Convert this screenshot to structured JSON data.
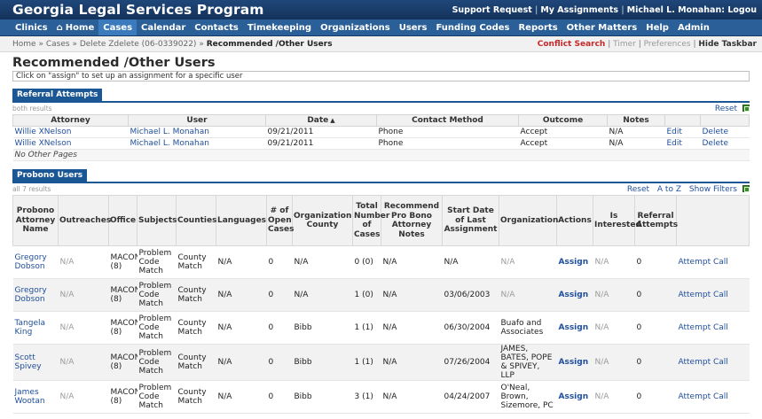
{
  "app": {
    "title": "Georgia Legal Services Program",
    "top_links": [
      "Support Request",
      "My Assignments",
      "Michael L. Monahan: Logou"
    ]
  },
  "nav": [
    {
      "label": "Clinics",
      "active": false,
      "icon": ""
    },
    {
      "label": "Home",
      "active": false,
      "icon": "home-icon"
    },
    {
      "label": "Cases",
      "active": true,
      "icon": ""
    },
    {
      "label": "Calendar",
      "active": false,
      "icon": ""
    },
    {
      "label": "Contacts",
      "active": false,
      "icon": ""
    },
    {
      "label": "Timekeeping",
      "active": false,
      "icon": ""
    },
    {
      "label": "Organizations",
      "active": false,
      "icon": ""
    },
    {
      "label": "Users",
      "active": false,
      "icon": ""
    },
    {
      "label": "Funding Codes",
      "active": false,
      "icon": ""
    },
    {
      "label": "Reports",
      "active": false,
      "icon": ""
    },
    {
      "label": "Other Matters",
      "active": false,
      "icon": ""
    },
    {
      "label": "Help",
      "active": false,
      "icon": ""
    },
    {
      "label": "Admin",
      "active": false,
      "icon": ""
    }
  ],
  "breadcrumb": {
    "items": [
      "Home",
      "Cases",
      "Delete Zdelete (06-0339022)"
    ],
    "separator": "»",
    "current": "Recommended /Other Users"
  },
  "tools": {
    "conflict_search": "Conflict Search",
    "timer": "Timer",
    "preferences": "Preferences",
    "hide_taskbar": "Hide Taskbar"
  },
  "page": {
    "title": "Recommended /Other Users",
    "instruction": "Click on \"assign\" to set up an assignment for a specific user"
  },
  "referral": {
    "tab_label": "Referral Attempts",
    "count_text": "both results",
    "reset_label": "Reset",
    "columns": [
      "Attorney",
      "User",
      "Date",
      "Contact Method",
      "Outcome",
      "Notes",
      "",
      ""
    ],
    "rows": [
      {
        "attorney": "Willie XNelson",
        "user": "Michael L. Monahan",
        "date": "09/21/2011",
        "method": "Phone",
        "outcome": "Accept",
        "notes": "N/A",
        "edit": "Edit",
        "delete": "Delete"
      },
      {
        "attorney": "Willie XNelson",
        "user": "Michael L. Monahan",
        "date": "09/21/2011",
        "method": "Phone",
        "outcome": "Accept",
        "notes": "N/A",
        "edit": "Edit",
        "delete": "Delete"
      }
    ],
    "footer": "No Other Pages"
  },
  "probono": {
    "tab_label": "Probono Users",
    "count_text": "all 7 results",
    "actions": [
      "Reset",
      "A to Z",
      "Show Filters"
    ],
    "columns": [
      "Probono Attorney Name",
      "Outreaches",
      "Office",
      "Subjects",
      "Counties",
      "Languages",
      "# of Open Cases",
      "Organization County",
      "Total Number of Cases",
      "Recommend Pro Bono Attorney Notes",
      "Start Date of Last Assignment",
      "Organization",
      "Actions",
      "Is Interested",
      "Referral Attempts",
      ""
    ],
    "rows": [
      {
        "name": "Gregory Dobson",
        "outreaches": "N/A",
        "office": "MACON (8)",
        "subjects": "Problem Code Match",
        "counties": "County Match",
        "languages": "N/A",
        "open": "0",
        "org_county": "N/A",
        "total": "0 (0)",
        "notes": "N/A",
        "start": "N/A",
        "organization": "N/A",
        "action": "Assign",
        "interested": "N/A",
        "attempts": "0",
        "attempt_call": "Attempt Call"
      },
      {
        "name": "Gregory Dobson",
        "outreaches": "N/A",
        "office": "MACON (8)",
        "subjects": "Problem Code Match",
        "counties": "County Match",
        "languages": "N/A",
        "open": "0",
        "org_county": "N/A",
        "total": "1 (0)",
        "notes": "N/A",
        "start": "03/06/2003",
        "organization": "N/A",
        "action": "Assign",
        "interested": "N/A",
        "attempts": "0",
        "attempt_call": "Attempt Call"
      },
      {
        "name": "Tangela King",
        "outreaches": "N/A",
        "office": "MACON (8)",
        "subjects": "Problem Code Match",
        "counties": "County Match",
        "languages": "N/A",
        "open": "0",
        "org_county": "Bibb",
        "total": "1 (1)",
        "notes": "N/A",
        "start": "06/30/2004",
        "organization": "Buafo and Associates",
        "action": "Assign",
        "interested": "N/A",
        "attempts": "0",
        "attempt_call": "Attempt Call"
      },
      {
        "name": "Scott Spivey",
        "outreaches": "N/A",
        "office": "MACON (8)",
        "subjects": "Problem Code Match",
        "counties": "County Match",
        "languages": "N/A",
        "open": "0",
        "org_county": "Bibb",
        "total": "1 (1)",
        "notes": "N/A",
        "start": "07/26/2004",
        "organization": "JAMES, BATES, POPE & SPIVEY, LLP",
        "action": "Assign",
        "interested": "N/A",
        "attempts": "0",
        "attempt_call": "Attempt Call"
      },
      {
        "name": "James Wootan",
        "outreaches": "N/A",
        "office": "MACON (8)",
        "subjects": "Problem Code Match",
        "counties": "County Match",
        "languages": "N/A",
        "open": "0",
        "org_county": "Bibb",
        "total": "3 (1)",
        "notes": "N/A",
        "start": "04/24/2007",
        "organization": "O'Neal, Brown, Sizemore, PC",
        "action": "Assign",
        "interested": "N/A",
        "attempts": "0",
        "attempt_call": "Attempt Call"
      }
    ]
  },
  "colors": {
    "header_bg": "#17375e",
    "nav_bg": "#2b5f97",
    "nav_active": "#3b7bbd",
    "section_tab": "#1b5794",
    "link": "#1f4e9c",
    "conflict": "#c62828"
  }
}
